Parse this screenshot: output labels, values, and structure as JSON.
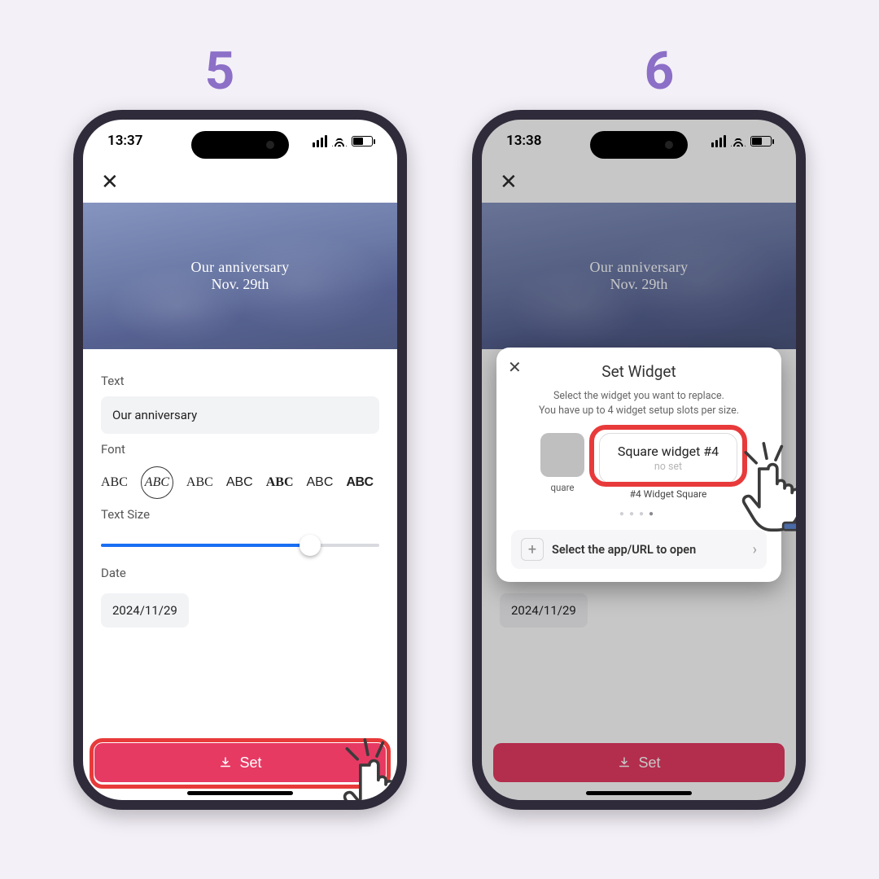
{
  "steps": {
    "left": "5",
    "right": "6"
  },
  "statusbar": {
    "time_left": "13:37",
    "time_right": "13:38"
  },
  "preview": {
    "line1": "Our anniversary",
    "line2": "Nov. 29th"
  },
  "form": {
    "text_label": "Text",
    "text_value": "Our anniversary",
    "font_label": "Font",
    "font_sample": "ABC",
    "size_label": "Text Size",
    "date_label": "Date",
    "date_value": "2024/11/29"
  },
  "set_button": "Set",
  "modal": {
    "title": "Set Widget",
    "sub1": "Select the widget you want to replace.",
    "sub2": "You have up to 4 widget setup slots per size.",
    "left_caption": "quare",
    "slot_title": "Square widget #4",
    "slot_status": "no set",
    "slot_caption": "#4 Widget Square",
    "open_label": "Select the app/URL to open"
  }
}
